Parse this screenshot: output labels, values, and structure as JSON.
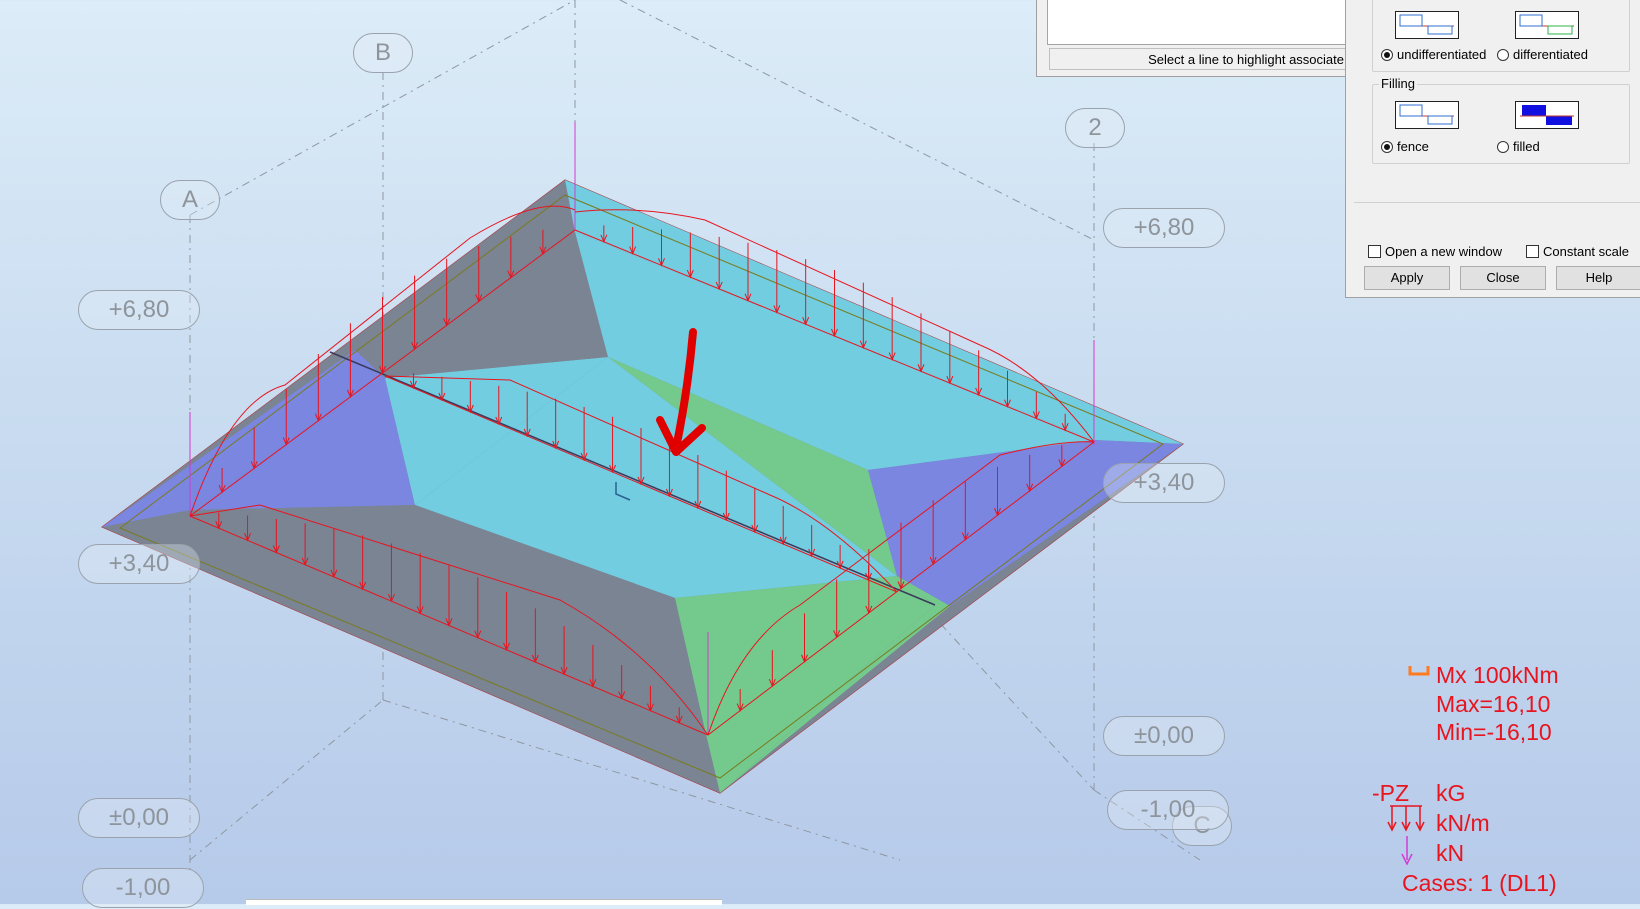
{
  "grid_labels": {
    "A": "A",
    "B": "B",
    "two": "2",
    "C": "C"
  },
  "levels": {
    "left_680": "+6,80",
    "left_340": "+3,40",
    "left_000": "±0,00",
    "left_neg100": "-1,00",
    "right_680": "+6,80",
    "right_340": "+3,40",
    "right_000": "±0,00",
    "right_neg100": "-1,00"
  },
  "dialog": {
    "status_hint": "Select a line to highlight associate",
    "filling_group": "Filling",
    "radio_undiff": "undifferentiated",
    "radio_diff": "differentiated",
    "radio_fence": "fence",
    "radio_filled": "filled",
    "opt_new_window": "Open a new window",
    "opt_const_scale": "Constant scale",
    "apply_label": "Apply",
    "close_label": "Close",
    "help_label": "Help"
  },
  "legend": {
    "moment": "Mx  100kNm",
    "max": "Max=16,10",
    "min": "Min=-16,10",
    "load_dir": "-PZ",
    "unit_kg": "kG",
    "unit_knm": "kN/m",
    "unit_kn": "kN",
    "cases": "Cases: 1 (DL1)"
  },
  "colors": {
    "slab_blue": "#72cde0",
    "slab_green": "#74c98d",
    "slab_gray": "#7a8493",
    "slab_violet": "#7a86e0",
    "diagram_red": "#e8141e",
    "support_magenta": "#d23cd2",
    "annotation_red": "#e00000"
  },
  "selected": {
    "distribution": "undifferentiated",
    "filling": "fence"
  }
}
